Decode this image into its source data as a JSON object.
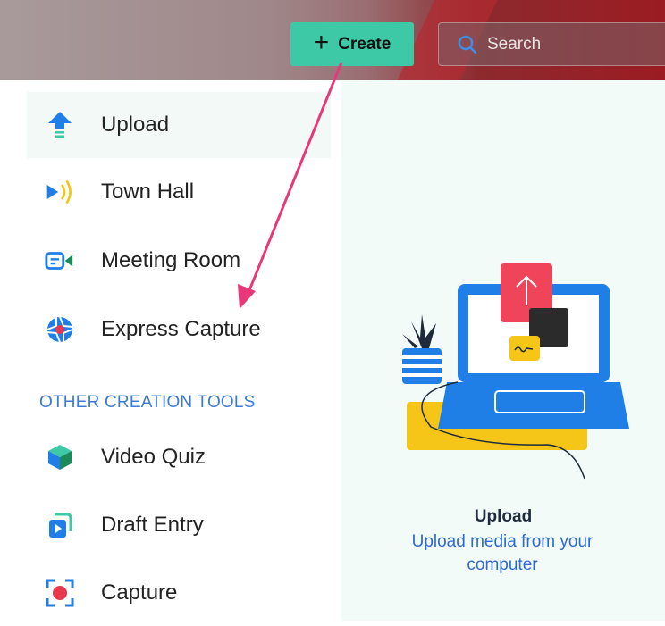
{
  "header": {
    "create_label": "Create",
    "search_placeholder": "Search"
  },
  "menu": {
    "items": [
      {
        "label": "Upload",
        "icon": "upload-icon"
      },
      {
        "label": "Town Hall",
        "icon": "town-hall-icon"
      },
      {
        "label": "Meeting Room",
        "icon": "meeting-room-icon"
      },
      {
        "label": "Express Capture",
        "icon": "express-capture-icon"
      }
    ],
    "section_title": "OTHER CREATION TOOLS",
    "other_items": [
      {
        "label": "Video Quiz",
        "icon": "video-quiz-icon"
      },
      {
        "label": "Draft Entry",
        "icon": "draft-entry-icon"
      },
      {
        "label": "Capture",
        "icon": "capture-icon"
      }
    ]
  },
  "preview": {
    "title": "Upload",
    "description": "Upload media from your computer"
  },
  "colors": {
    "accent_green": "#3ec9a6",
    "section_blue": "#3a7bd5",
    "arrow_pink": "#e8387a"
  }
}
